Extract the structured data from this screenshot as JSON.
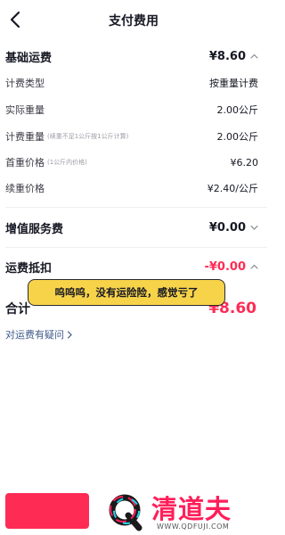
{
  "header": {
    "title": "支付费用"
  },
  "base_fee": {
    "label": "基础运费",
    "amount": "¥8.60",
    "items": [
      {
        "label": "计费类型",
        "note": "",
        "value": "按重量计费"
      },
      {
        "label": "实际重量",
        "note": "",
        "value": "2.00公斤"
      },
      {
        "label": "计费重量",
        "note": "(续重不足1公斤按1公斤计算)",
        "value": "2.00公斤"
      },
      {
        "label": "首重价格",
        "note": "(1公斤内价格)",
        "value": "¥6.20"
      },
      {
        "label": "续重价格",
        "note": "",
        "value": "¥2.40/公斤"
      }
    ]
  },
  "value_added": {
    "label": "增值服务费",
    "amount": "¥0.00"
  },
  "deduction": {
    "label": "运费抵扣",
    "amount": "-¥0.00"
  },
  "total": {
    "label": "合计",
    "amount": "¥8.60"
  },
  "help_link": {
    "label": "对运费有疑问"
  },
  "caption": {
    "text": "呜呜呜，没有运险险，感觉亏了"
  },
  "watermark": {
    "name": "清道夫",
    "url": "WWW.QDFUJI.COM"
  },
  "colors": {
    "accent": "#fe2c55",
    "caption_bg": "#f7d34a",
    "link": "#3f5a8a"
  }
}
